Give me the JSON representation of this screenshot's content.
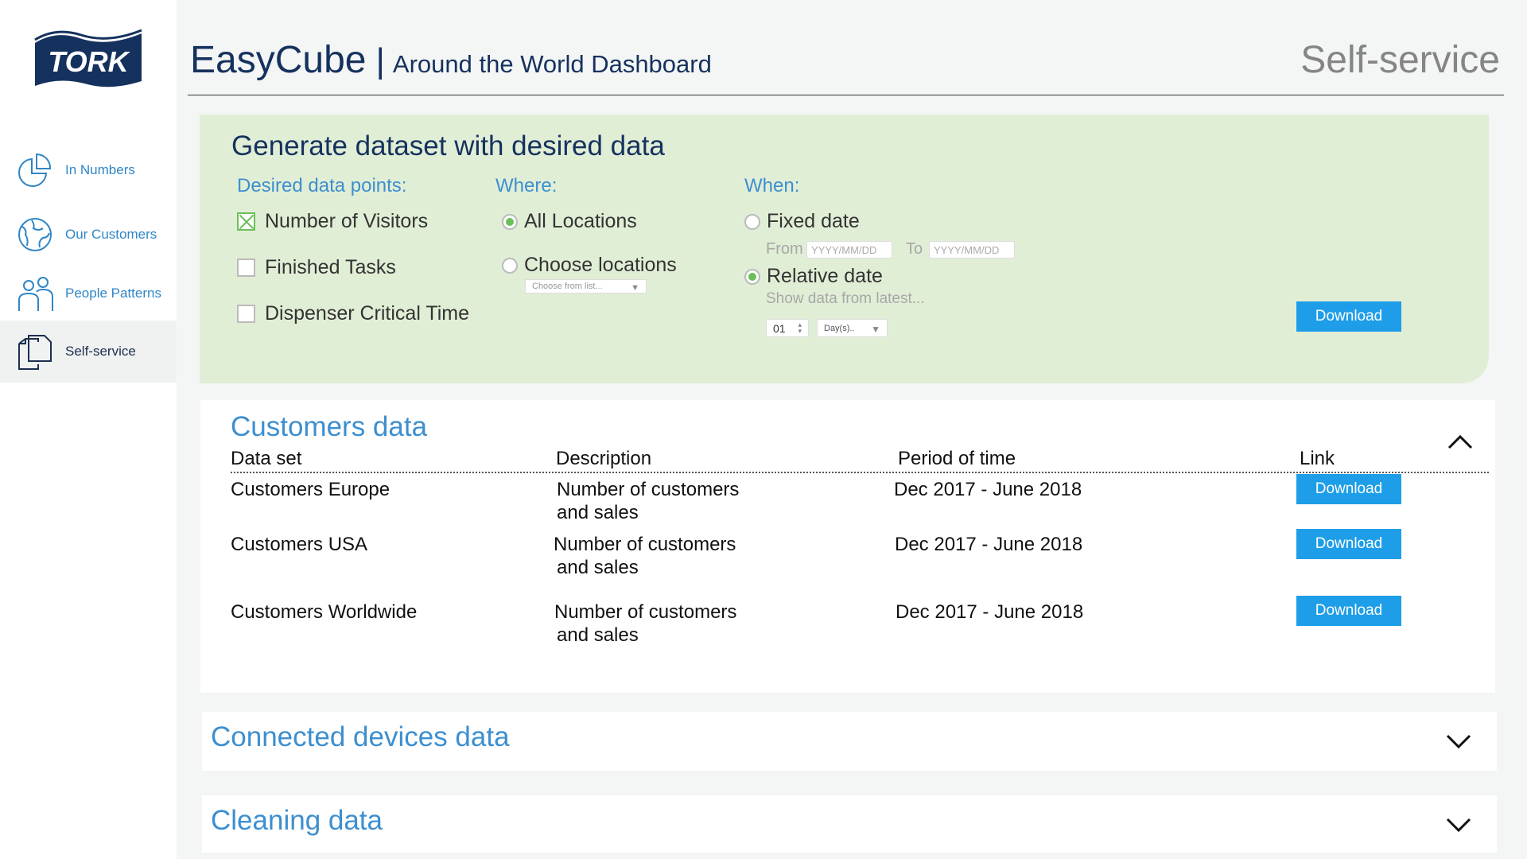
{
  "brand": {
    "logo_text": "TORK"
  },
  "sidebar": {
    "items": [
      {
        "label": "In Numbers",
        "icon": "pie-chart-icon"
      },
      {
        "label": "Our Customers",
        "icon": "globe-icon"
      },
      {
        "label": "People Patterns",
        "icon": "people-icon"
      },
      {
        "label": "Self-service",
        "icon": "documents-icon",
        "active": true
      }
    ]
  },
  "header": {
    "app_name": "EasyCube",
    "separator": "|",
    "dashboard_name": "Around the World Dashboard",
    "section": "Self-service"
  },
  "generate": {
    "title": "Generate dataset with desired data",
    "data_points_label": "Desired data points:",
    "data_points": [
      {
        "label": "Number of Visitors",
        "checked": true
      },
      {
        "label": "Finished Tasks",
        "checked": false
      },
      {
        "label": "Dispenser Critical Time",
        "checked": false
      }
    ],
    "where_label": "Where:",
    "where_options": [
      {
        "label": "All Locations",
        "selected": true
      },
      {
        "label": "Choose locations",
        "selected": false
      }
    ],
    "locations_select_placeholder": "Choose from list...",
    "when_label": "When:",
    "fixed_date_label": "Fixed date",
    "from_label": "From",
    "from_placeholder": "YYYY/MM/DD",
    "to_label": "To",
    "to_placeholder": "YYYY/MM/DD",
    "relative_date_label": "Relative date",
    "relative_selected": true,
    "show_data_label": "Show data from latest...",
    "amount_value": "01",
    "unit_value": "Day(s)..",
    "download_label": "Download"
  },
  "customers": {
    "title": "Customers data",
    "columns": [
      "Data set",
      "Description",
      "Period of time",
      "Link"
    ],
    "rows": [
      {
        "dataset": "Customers Europe",
        "description_line1": "Number of customers",
        "description_line2": "and sales",
        "period": "Dec 2017 - June 2018",
        "link": "Download"
      },
      {
        "dataset": "Customers USA",
        "description_line1": "Number of customers",
        "description_line2": "and sales",
        "period": "Dec 2017 - June 2018",
        "link": "Download"
      },
      {
        "dataset": "Customers Worldwide",
        "description_line1": "Number of customers",
        "description_line2": "and sales",
        "period": "Dec 2017 - June 2018",
        "link": "Download"
      }
    ]
  },
  "connected_devices": {
    "title": "Connected devices data"
  },
  "cleaning": {
    "title": "Cleaning data"
  },
  "colors": {
    "navy": "#15325e",
    "accent_blue": "#3d8fcf",
    "button_blue": "#1e9ee8",
    "panel_green": "#e1eed6",
    "check_green": "#6bbf59"
  }
}
